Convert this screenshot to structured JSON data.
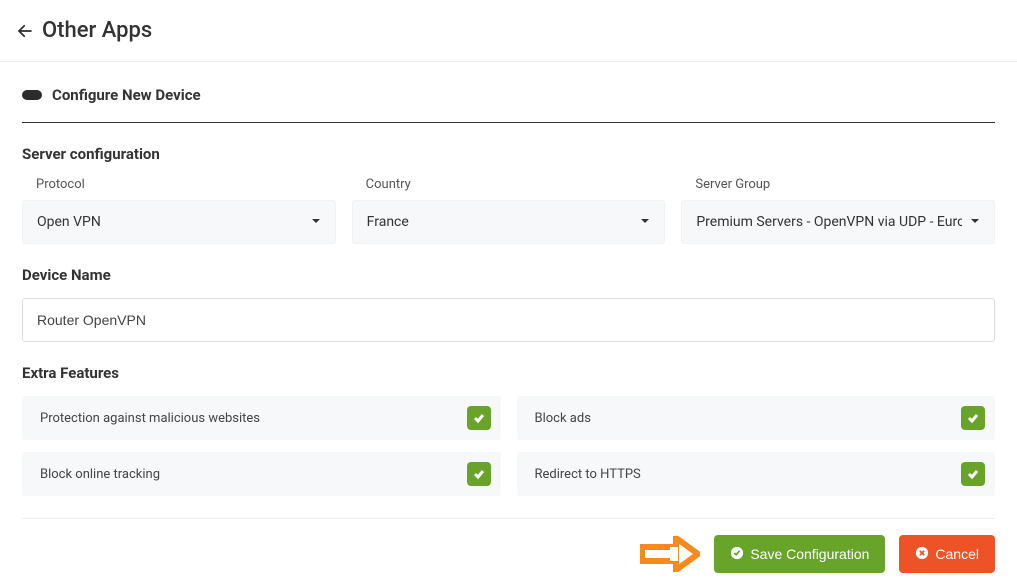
{
  "header": {
    "title": "Other Apps"
  },
  "section": {
    "title": "Configure New Device"
  },
  "server": {
    "heading": "Server configuration",
    "protocol": {
      "label": "Protocol",
      "value": "Open VPN"
    },
    "country": {
      "label": "Country",
      "value": "France"
    },
    "group": {
      "label": "Server Group",
      "value": "Premium Servers - OpenVPN via UDP - Europe"
    }
  },
  "device": {
    "heading": "Device Name",
    "value": "Router OpenVPN"
  },
  "features": {
    "heading": "Extra Features",
    "items": [
      {
        "label": "Protection against malicious websites",
        "on": true
      },
      {
        "label": "Block ads",
        "on": true
      },
      {
        "label": "Block online tracking",
        "on": true
      },
      {
        "label": "Redirect to HTTPS",
        "on": true
      }
    ]
  },
  "actions": {
    "save": "Save Configuration",
    "cancel": "Cancel"
  },
  "colors": {
    "green": "#68a32a",
    "orange": "#ed5326",
    "callout": "#f58a1e"
  }
}
